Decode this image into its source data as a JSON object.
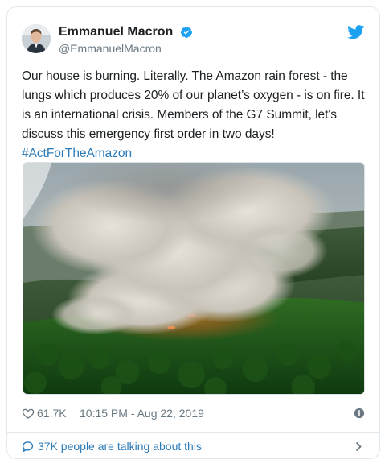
{
  "author": {
    "display_name": "Emmanuel Macron",
    "handle": "@EmmanuelMacron",
    "verified": true
  },
  "tweet": {
    "text": "Our house is burning. Literally. The Amazon rain forest - the lungs which produces 20% of our planet’s oxygen - is on fire. It is an international crisis. Members of the G7 Summit, let's discuss this emergency first order in two days!",
    "hashtag": "#ActForTheAmazon"
  },
  "stats": {
    "likes": "61.7K",
    "timestamp": "10:15 PM - Aug 22, 2019"
  },
  "footer": {
    "conversation_label": "37K people are talking about this"
  },
  "icons": {
    "brand": "twitter-bird-icon",
    "verified": "verified-badge-icon",
    "like": "heart-icon",
    "info": "info-icon",
    "conversation": "speech-bubble-icon",
    "more": "chevron-right-icon"
  },
  "colors": {
    "brand_blue": "#1da1f2",
    "link_blue": "#2b7bb9",
    "text": "#1c2022",
    "muted": "#697882",
    "border": "#e1e8ed"
  }
}
